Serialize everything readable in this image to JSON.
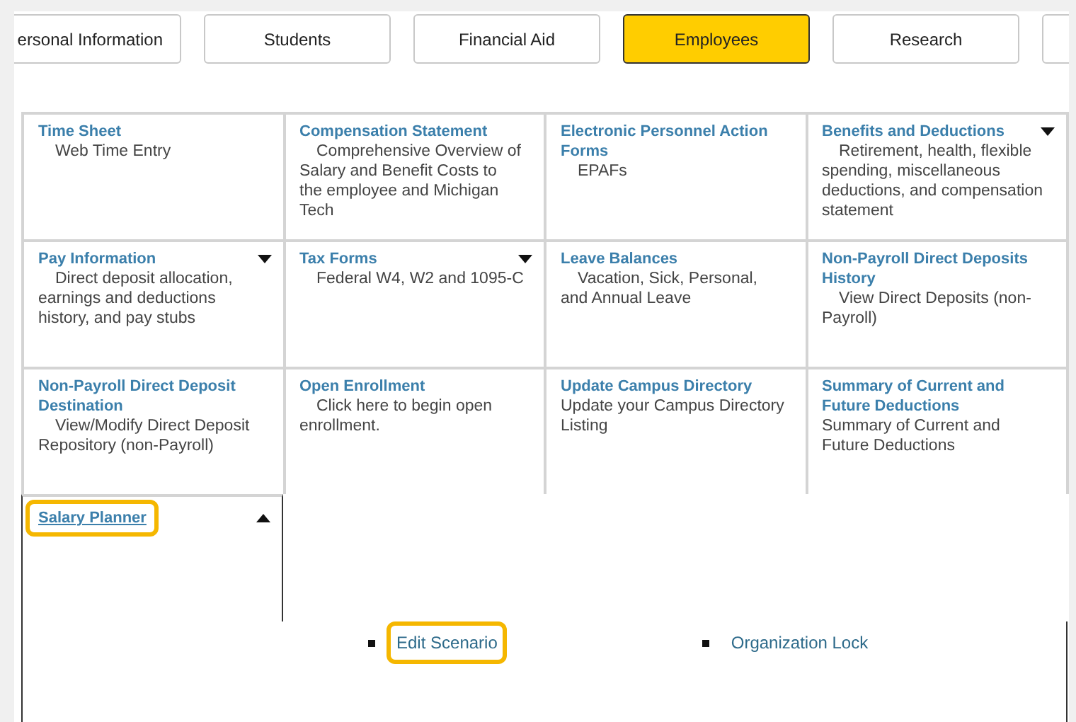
{
  "tabs": [
    {
      "label": "ersonal Information",
      "selected": false
    },
    {
      "label": "Students",
      "selected": false
    },
    {
      "label": "Financial Aid",
      "selected": false
    },
    {
      "label": "Employees",
      "selected": true
    },
    {
      "label": "Research",
      "selected": false
    }
  ],
  "tiles": [
    {
      "title": "Time Sheet",
      "description": "Web Time Entry",
      "indent": true,
      "dropdown": false
    },
    {
      "title": "Compensation Statement",
      "description": "Comprehensive Overview of Salary and Benefit Costs to the employee and Michigan Tech",
      "indent": true,
      "dropdown": false
    },
    {
      "title": "Electronic Personnel Action Forms",
      "description": "EPAFs",
      "indent": true,
      "dropdown": false
    },
    {
      "title": "Benefits and Deductions",
      "description": "Retirement, health, flexible spending, miscellaneous deductions, and compensation statement",
      "indent": true,
      "dropdown": true
    },
    {
      "title": "Pay Information",
      "description": "Direct deposit allocation, earnings and deductions history, and pay stubs",
      "indent": true,
      "dropdown": true
    },
    {
      "title": "Tax Forms",
      "description": "Federal W4, W2 and 1095-C",
      "indent": true,
      "dropdown": true
    },
    {
      "title": "Leave Balances",
      "description": "Vacation, Sick, Personal, and Annual Leave",
      "indent": true,
      "dropdown": false
    },
    {
      "title": "Non-Payroll Direct Deposits History",
      "description": "View Direct Deposits (non-Payroll)",
      "indent": true,
      "dropdown": false
    },
    {
      "title": "Non-Payroll Direct Deposit Destination",
      "description": "View/Modify Direct Deposit Repository (non-Payroll)",
      "indent": true,
      "dropdown": false
    },
    {
      "title": "Open Enrollment",
      "description": "Click here to begin open enrollment.",
      "indent": true,
      "dropdown": false
    },
    {
      "title": "Update Campus Directory",
      "description": "Update your Campus Directory Listing",
      "indent": false,
      "dropdown": false
    },
    {
      "title": "Summary of Current and Future Deductions",
      "description": "Summary of Current and Future Deductions",
      "indent": false,
      "dropdown": false
    }
  ],
  "salary_planner": {
    "title": "Salary Planner",
    "highlighted": true,
    "expanded": true,
    "links": [
      {
        "label": "Edit Scenario",
        "highlighted": true
      },
      {
        "label": "Organization Lock",
        "highlighted": false
      }
    ]
  }
}
